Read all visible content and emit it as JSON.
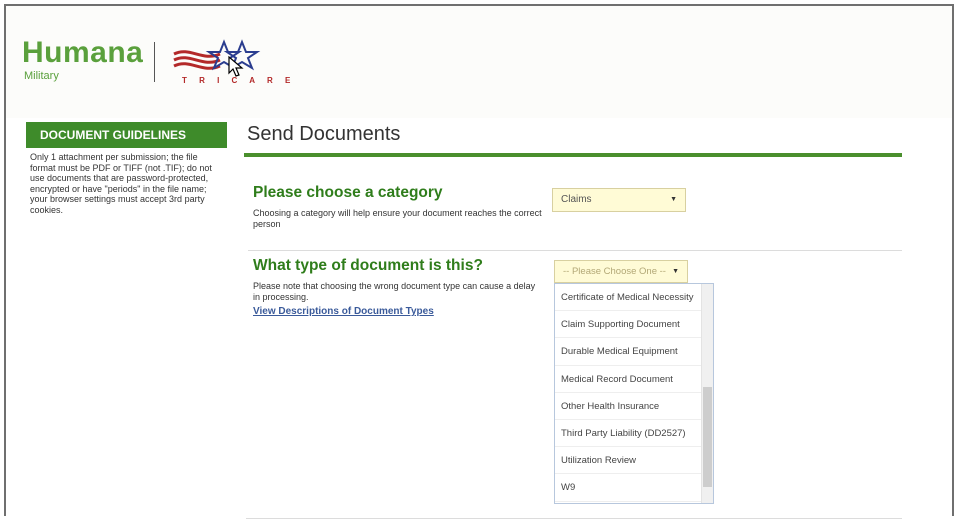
{
  "header": {
    "brand_name": "Humana",
    "brand_sub": "Military",
    "partner_text": "T R I C A R E",
    "partner_logo": "tricare-logo"
  },
  "sidebar": {
    "title": "DOCUMENT GUIDELINES",
    "body": "Only 1 attachment per submission; the file format must be PDF or TIFF (not .TIF); do not use documents that are password-protected, encrypted or have \"periods\" in the file name; your browser settings must accept 3rd party cookies."
  },
  "main": {
    "title": "Send Documents",
    "category": {
      "question": "Please choose a category",
      "description": "Choosing a category will help ensure your document reaches the correct person",
      "selected": "Claims"
    },
    "doc_type": {
      "question": "What type of document is this?",
      "description": "Please note that choosing the wrong document type can cause a delay in processing.",
      "link": "View Descriptions of Document Types",
      "placeholder": "-- Please Choose One --",
      "options": [
        "Certificate of Medical Necessity",
        "Claim Supporting Document",
        "Durable Medical Equipment",
        "Medical Record Document",
        "Other Health Insurance",
        "Third Party Liability (DD2527)",
        "Utilization Review",
        "W9"
      ]
    }
  },
  "colors": {
    "brand_green": "#5aa03c",
    "section_green": "#3e8b2a",
    "select_bg": "#fffbd6"
  }
}
